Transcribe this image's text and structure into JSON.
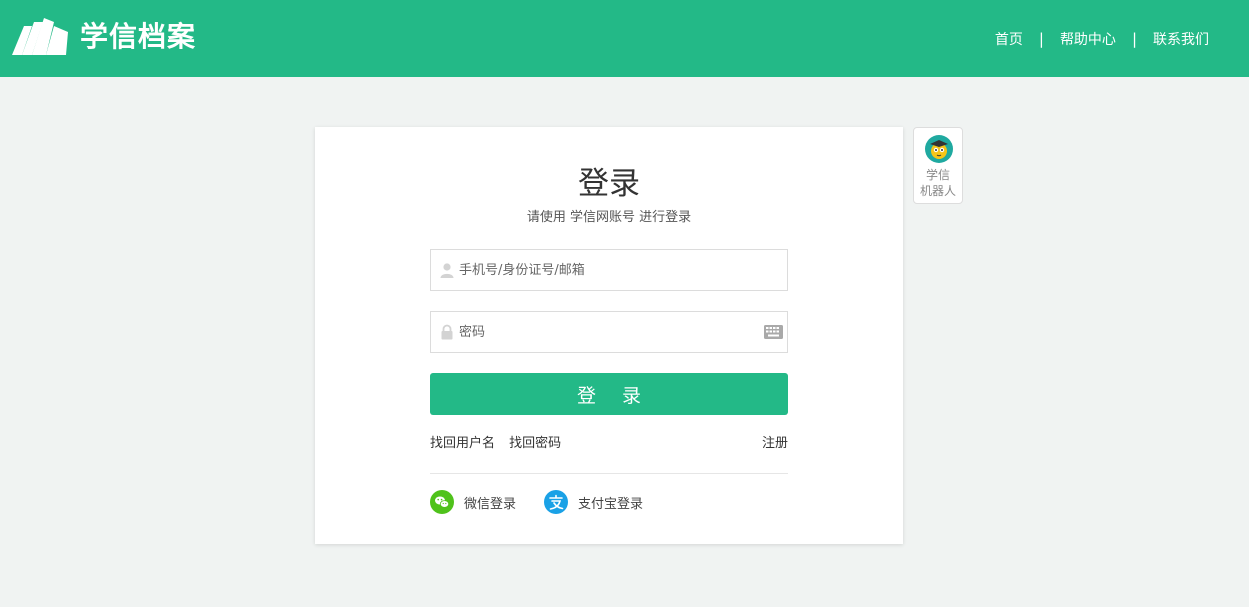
{
  "header": {
    "logo_text": "学信档案",
    "nav": [
      {
        "label": "首页"
      },
      {
        "label": "帮助中心"
      },
      {
        "label": "联系我们"
      }
    ],
    "separator": "|"
  },
  "login": {
    "title": "登录",
    "subtitle": "请使用 学信网账号 进行登录",
    "username_placeholder": "手机号/身份证号/邮箱",
    "username_value": "",
    "password_placeholder": "密码",
    "password_value": "",
    "submit_label": "登 录",
    "find_username": "找回用户名",
    "find_password": "找回密码",
    "register": "注册",
    "wechat_login": "微信登录",
    "alipay_login": "支付宝登录"
  },
  "robot": {
    "label_line1": "学信",
    "label_line2": "机器人"
  },
  "icons": {
    "user": "user-icon",
    "lock": "lock-icon",
    "keyboard": "keyboard-icon",
    "wechat": "wechat-icon",
    "alipay": "alipay-icon",
    "robot": "robot-avatar-icon"
  },
  "colors": {
    "brand": "#23b987",
    "wechat": "#4fc21b",
    "alipay": "#1aa1e6",
    "background": "#f0f3f2"
  }
}
